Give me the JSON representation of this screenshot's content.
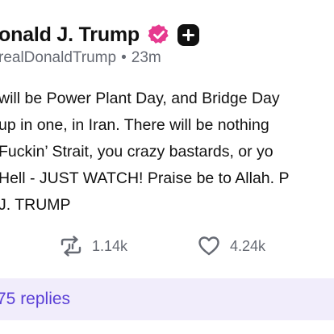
{
  "post": {
    "author_name": "onald J. Trump",
    "author_handle": "realDonaldTrump",
    "separator": "•",
    "timestamp": "23m",
    "body_lines": [
      "will be Power Plant Day, and Bridge Day",
      "up in one, in Iran. There will be nothing",
      "Fuckin’ Strait, you crazy bastards, or yo",
      "Hell - JUST WATCH! Praise be to Allah. P",
      "J. TRUMP"
    ],
    "reposts_count": "1.14k",
    "likes_count": "4.24k",
    "replies_label": "75 replies"
  },
  "icons": {
    "verified": "verified-badge-icon",
    "add": "plus-icon",
    "repost": "repost-icon",
    "like": "heart-icon"
  },
  "colors": {
    "verified_badge": "#e63a8f",
    "accent": "#5a3fd6",
    "replies_bg": "#f1edfb",
    "muted_text": "#666a73"
  }
}
